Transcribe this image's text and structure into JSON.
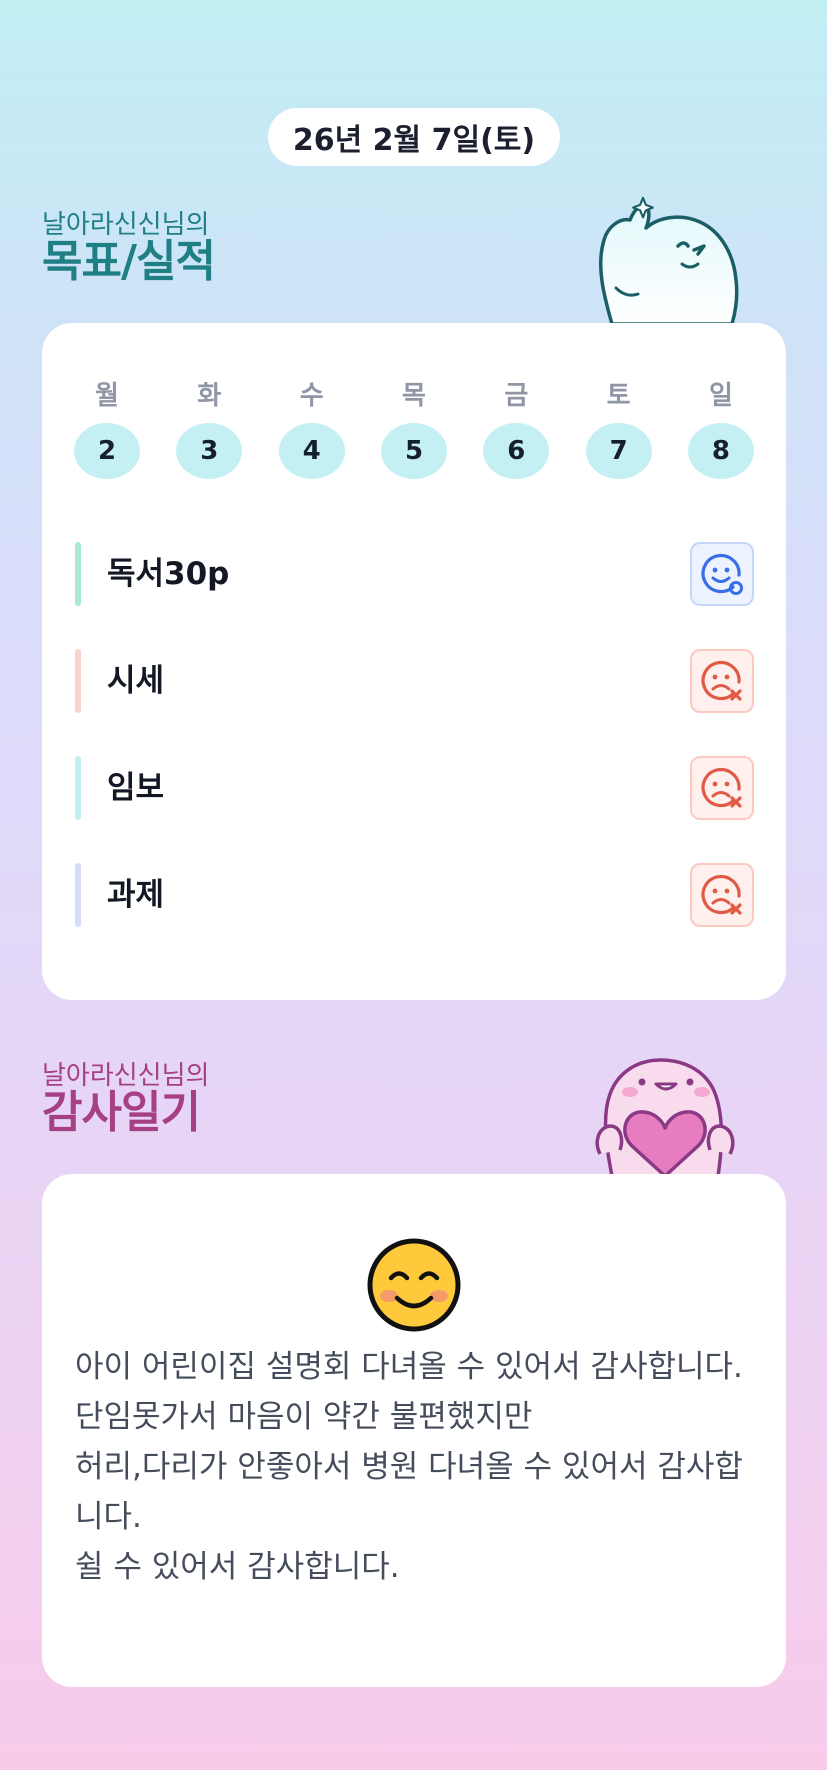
{
  "date_label": "26년 2월 7일(토)",
  "goal_section": {
    "owner": "날아라신신님의",
    "title": "목표/실적"
  },
  "week": [
    {
      "day": "월",
      "date": "2"
    },
    {
      "day": "화",
      "date": "3"
    },
    {
      "day": "수",
      "date": "4"
    },
    {
      "day": "목",
      "date": "5"
    },
    {
      "day": "금",
      "date": "6"
    },
    {
      "day": "토",
      "date": "7"
    },
    {
      "day": "일",
      "date": "8"
    }
  ],
  "goals": [
    {
      "label": "독서30p",
      "status": "done",
      "bar_color": "#a9ead8"
    },
    {
      "label": "시세",
      "status": "not_done",
      "bar_color": "#fbd2cd"
    },
    {
      "label": "임보",
      "status": "not_done",
      "bar_color": "#c2f0f2"
    },
    {
      "label": "과제",
      "status": "not_done",
      "bar_color": "#d4dcfa"
    }
  ],
  "diary_section": {
    "owner": "날아라신신님의",
    "title": "감사일기"
  },
  "diary": {
    "mood_icon": "smiling-face-icon",
    "lines": [
      "아이 어린이집 설명회 다녀올 수 있어서 감사합니다.",
      "단임못가서 마음이 약간 불편했지만",
      "허리,다리가 안좋아서 병원 다녀올 수 있어서 감사합니다.",
      "쉴 수 있어서 감사합니다."
    ]
  },
  "colors": {
    "goal_title": "#1f7f84",
    "diary_title": "#a63f83",
    "day_circle": "#c5f0f3",
    "done_icon": "#3a6ee8",
    "not_done_icon": "#e05a45"
  }
}
